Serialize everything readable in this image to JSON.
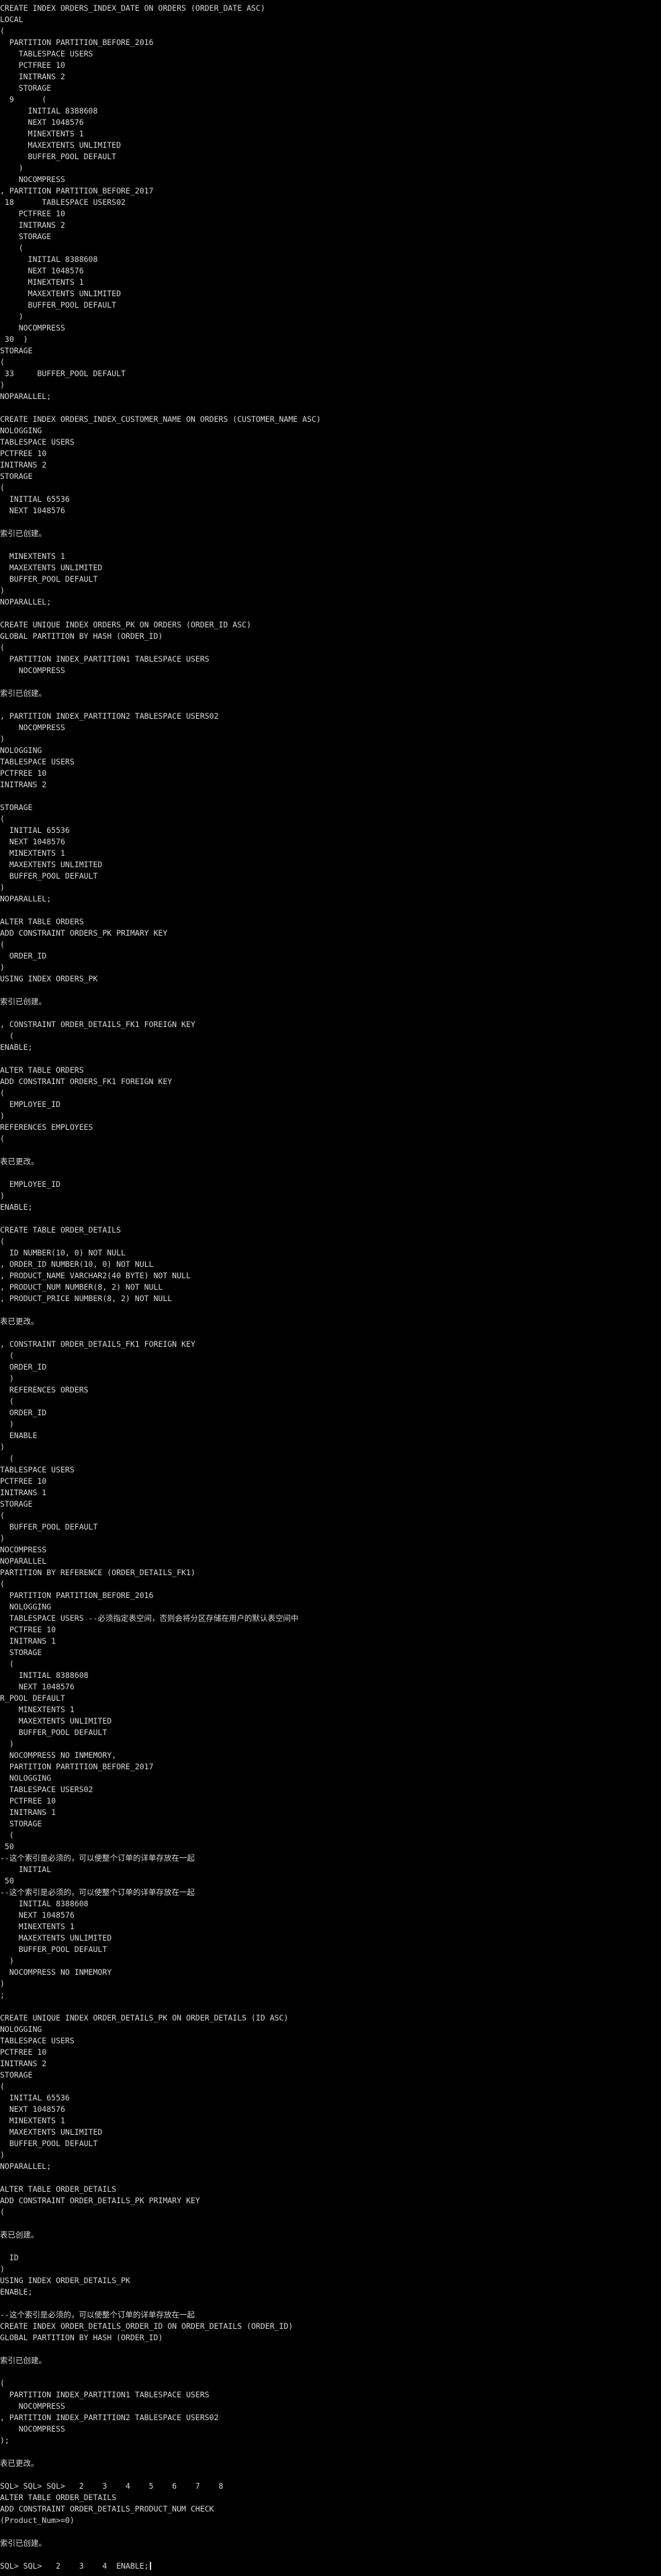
{
  "colors": {
    "background": "#000000",
    "text": "#d8d8d8"
  },
  "terminal": {
    "lines": [
      "CREATE INDEX ORDERS_INDEX_DATE ON ORDERS (ORDER_DATE ASC)",
      "LOCAL",
      "(",
      "  PARTITION PARTITION_BEFORE_2016",
      "    TABLESPACE USERS",
      "    PCTFREE 10",
      "    INITRANS 2",
      "    STORAGE",
      "  9      (",
      "      INITIAL 8388608",
      "      NEXT 1048576",
      "      MINEXTENTS 1",
      "      MAXEXTENTS UNLIMITED",
      "      BUFFER_POOL DEFAULT",
      "    )",
      "    NOCOMPRESS",
      ", PARTITION PARTITION_BEFORE_2017",
      " 18      TABLESPACE USERS02",
      "    PCTFREE 10",
      "    INITRANS 2",
      "    STORAGE",
      "    (",
      "      INITIAL 8388608",
      "      NEXT 1048576",
      "      MINEXTENTS 1",
      "      MAXEXTENTS UNLIMITED",
      "      BUFFER_POOL DEFAULT",
      "    )",
      "    NOCOMPRESS",
      " 30  )",
      "STORAGE",
      "(",
      " 33     BUFFER_POOL DEFAULT",
      ")",
      "NOPARALLEL;",
      "",
      "CREATE INDEX ORDERS_INDEX_CUSTOMER_NAME ON ORDERS (CUSTOMER_NAME ASC)",
      "NOLOGGING",
      "TABLESPACE USERS",
      "PCTFREE 10",
      "INITRANS 2",
      "STORAGE",
      "(",
      "  INITIAL 65536",
      "  NEXT 1048576",
      "",
      "索引已创建。",
      "",
      "  MINEXTENTS 1",
      "  MAXEXTENTS UNLIMITED",
      "  BUFFER_POOL DEFAULT",
      ")",
      "NOPARALLEL;",
      "",
      "CREATE UNIQUE INDEX ORDERS_PK ON ORDERS (ORDER_ID ASC)",
      "GLOBAL PARTITION BY HASH (ORDER_ID)",
      "(",
      "  PARTITION INDEX_PARTITION1 TABLESPACE USERS",
      "    NOCOMPRESS",
      "",
      "索引已创建。",
      "",
      ", PARTITION INDEX_PARTITION2 TABLESPACE USERS02",
      "    NOCOMPRESS",
      ")",
      "NOLOGGING",
      "TABLESPACE USERS",
      "PCTFREE 10",
      "INITRANS 2",
      "",
      "STORAGE",
      "(",
      "  INITIAL 65536",
      "  NEXT 1048576",
      "  MINEXTENTS 1",
      "  MAXEXTENTS UNLIMITED",
      "  BUFFER_POOL DEFAULT",
      ")",
      "NOPARALLEL;",
      "",
      "ALTER TABLE ORDERS",
      "ADD CONSTRAINT ORDERS_PK PRIMARY KEY",
      "(",
      "  ORDER_ID",
      ")",
      "USING INDEX ORDERS_PK",
      "",
      "索引已创建。",
      "",
      ", CONSTRAINT ORDER_DETAILS_FK1 FOREIGN KEY",
      "  (",
      "ENABLE;",
      "",
      "ALTER TABLE ORDERS",
      "ADD CONSTRAINT ORDERS_FK1 FOREIGN KEY",
      "(",
      "  EMPLOYEE_ID",
      ")",
      "REFERENCES EMPLOYEES",
      "(",
      "",
      "表已更改。",
      "",
      "  EMPLOYEE_ID",
      ")",
      "ENABLE;",
      "",
      "CREATE TABLE ORDER_DETAILS",
      "(",
      "  ID NUMBER(10, 0) NOT NULL",
      ", ORDER_ID NUMBER(10, 0) NOT NULL",
      ", PRODUCT_NAME VARCHAR2(40 BYTE) NOT NULL",
      ", PRODUCT_NUM NUMBER(8, 2) NOT NULL",
      ", PRODUCT_PRICE NUMBER(8, 2) NOT NULL",
      "",
      "表已更改。",
      "",
      ", CONSTRAINT ORDER_DETAILS_FK1 FOREIGN KEY",
      "  (",
      "  ORDER_ID",
      "  )",
      "  REFERENCES ORDERS",
      "  (",
      "  ORDER_ID",
      "  )",
      "  ENABLE",
      ")",
      "  (",
      "TABLESPACE USERS",
      "PCTFREE 10",
      "INITRANS 1",
      "STORAGE",
      "(",
      "  BUFFER_POOL DEFAULT",
      ")",
      "NOCOMPRESS",
      "NOPARALLEL",
      "PARTITION BY REFERENCE (ORDER_DETAILS_FK1)",
      "(",
      "  PARTITION PARTITION_BEFORE_2016",
      "  NOLOGGING",
      "  TABLESPACE USERS --必须指定表空间，否则会将分区存储在用户的默认表空间中",
      "  PCTFREE 10",
      "  INITRANS 1",
      "  STORAGE",
      "  (",
      "    INITIAL 8388608",
      "    NEXT 1048576",
      "R_POOL DEFAULT",
      "    MINEXTENTS 1",
      "    MAXEXTENTS UNLIMITED",
      "    BUFFER_POOL DEFAULT",
      "  )",
      "  NOCOMPRESS NO INMEMORY,",
      "  PARTITION PARTITION_BEFORE_2017",
      "  NOLOGGING",
      "  TABLESPACE USERS02",
      "  PCTFREE 10",
      "  INITRANS 1",
      "  STORAGE",
      "  (",
      " 50",
      "--这个索引是必须的，可以使整个订单的详单存放在一起",
      "    INITIAL",
      " 50",
      "--这个索引是必须的，可以使整个订单的详单存放在一起",
      "    INITIAL 8388608",
      "    NEXT 1048576",
      "    MINEXTENTS 1",
      "    MAXEXTENTS UNLIMITED",
      "    BUFFER_POOL DEFAULT",
      "  )",
      "  NOCOMPRESS NO INMEMORY",
      ")",
      ";",
      "",
      "CREATE UNIQUE INDEX ORDER_DETAILS_PK ON ORDER_DETAILS (ID ASC)",
      "NOLOGGING",
      "TABLESPACE USERS",
      "PCTFREE 10",
      "INITRANS 2",
      "STORAGE",
      "(",
      "  INITIAL 65536",
      "  NEXT 1048576",
      "  MINEXTENTS 1",
      "  MAXEXTENTS UNLIMITED",
      "  BUFFER_POOL DEFAULT",
      ")",
      "NOPARALLEL;",
      "",
      "ALTER TABLE ORDER_DETAILS",
      "ADD CONSTRAINT ORDER_DETAILS_PK PRIMARY KEY",
      "(",
      "",
      "表已创建。",
      "",
      "  ID",
      ")",
      "USING INDEX ORDER_DETAILS_PK",
      "ENABLE;",
      "",
      "--这个索引是必须的，可以使整个订单的详单存放在一起",
      "CREATE INDEX ORDER_DETAILS_ORDER_ID ON ORDER_DETAILS (ORDER_ID)",
      "GLOBAL PARTITION BY HASH (ORDER_ID)",
      "",
      "索引已创建。",
      "",
      "(",
      "  PARTITION INDEX_PARTITION1 TABLESPACE USERS",
      "    NOCOMPRESS",
      ", PARTITION INDEX_PARTITION2 TABLESPACE USERS02",
      "    NOCOMPRESS",
      ");",
      "",
      "表已更改。",
      "",
      "SQL> SQL> SQL>   2    3    4    5    6    7    8",
      "ALTER TABLE ORDER_DETAILS",
      "ADD CONSTRAINT ORDER_DETAILS_PRODUCT_NUM CHECK",
      "(Product_Num>=0)",
      "",
      "索引已创建。",
      "",
      "SQL> SQL>   2    3    4  ENABLE;"
    ]
  }
}
